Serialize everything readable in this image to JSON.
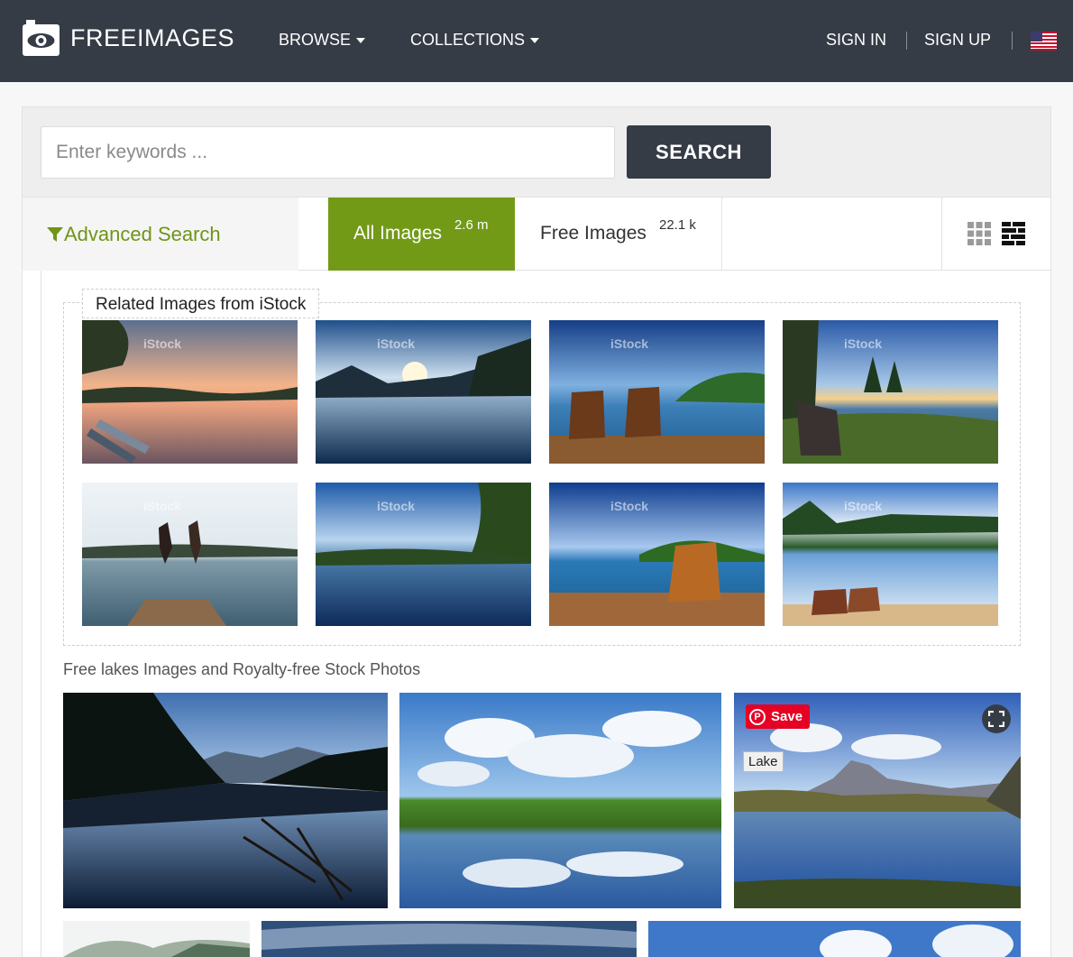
{
  "header": {
    "logo_text": "FREEIMAGES",
    "nav": [
      {
        "label": "BROWSE"
      },
      {
        "label": "COLLECTIONS"
      }
    ],
    "sign_in": "SIGN IN",
    "sign_up": "SIGN UP",
    "flag_icon": "us-flag-icon"
  },
  "search": {
    "placeholder": "Enter keywords ...",
    "value": "",
    "button_label": "SEARCH"
  },
  "filters": {
    "advanced_label": "Advanced Search",
    "tabs": [
      {
        "label": "All Images",
        "count": "2.6 m",
        "active": true
      },
      {
        "label": "Free Images",
        "count": "22.1 k",
        "active": false
      }
    ],
    "view_modes": [
      "grid-view-icon",
      "masonry-view-icon"
    ]
  },
  "related": {
    "title": "Related Images from iStock",
    "watermark": "iStock",
    "thumbs": [
      {
        "alt": "sunset lake with canoes"
      },
      {
        "alt": "misty mountain lake sunrise"
      },
      {
        "alt": "two adirondack chairs on dock"
      },
      {
        "alt": "chair by lake at sunset"
      },
      {
        "alt": "couple jumping off pier"
      },
      {
        "alt": "sun flare over lake"
      },
      {
        "alt": "chair on dock blue lake"
      },
      {
        "alt": "lake shore with chairs"
      }
    ]
  },
  "results": {
    "title": "Free lakes Images and Royalty-free Stock Photos",
    "pin_save_label": "Save",
    "tag_label": "Lake",
    "colors": {
      "accent_green": "#729a17",
      "header_dark": "#353c46",
      "pinterest_red": "#e60023"
    }
  }
}
